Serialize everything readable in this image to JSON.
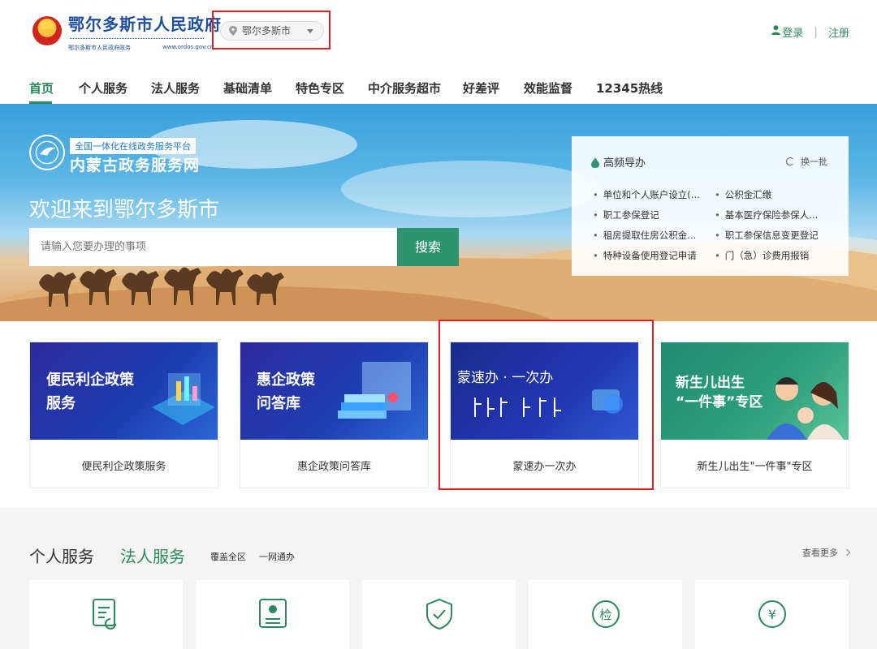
{
  "header": {
    "site_title": "鄂尔多斯市人民政府",
    "site_sub": "鄂尔多斯市人民政府政务",
    "site_domain": "www.ordos.gov.cn",
    "city_selector": "鄂尔多斯市",
    "login": "登录",
    "register": "注册"
  },
  "nav": {
    "items": [
      "首页",
      "个人服务",
      "法人服务",
      "基础清单",
      "特色专区",
      "中介服务超市",
      "好差评",
      "效能监督",
      "12345热线"
    ],
    "active_index": 0
  },
  "banner": {
    "platform_tag": "全国一体化在线政务服务平台",
    "platform_name": "内蒙古政务服务网",
    "welcome": "欢迎来到鄂尔多斯市",
    "search_placeholder": "请输入您要办理的事项",
    "search_button": "搜索"
  },
  "quick_guide": {
    "title": "高频导办",
    "refresh": "换一批",
    "items": [
      "单位和个人账户设立(...",
      "公积金汇缴",
      "职工参保登记",
      "基本医疗保险参保人...",
      "租房提取住房公积金...",
      "职工参保信息变更登记",
      "特种设备使用登记申请",
      "门（急）诊费用报销"
    ]
  },
  "cards": [
    {
      "image_text": [
        "便民利企政策",
        "服务"
      ],
      "label": "便民利企政策服务"
    },
    {
      "image_text": [
        "惠企政策",
        "问答库"
      ],
      "label": "惠企政策问答库"
    },
    {
      "image_text": [
        "蒙速办 · 一次办"
      ],
      "label": "蒙速办一次办"
    },
    {
      "image_text": [
        "新生儿出生",
        "“一件事”专区"
      ],
      "label": "新生儿出生\"一件事\"专区"
    }
  ],
  "services": {
    "tab_personal": "个人服务",
    "tab_legal": "法人服务",
    "cover_1": "覆盖全区",
    "cover_2": "一网通办",
    "more": "查看更多"
  },
  "tile_icons": [
    "form-refresh-icon",
    "id-card-icon",
    "shield-check-icon",
    "inspect-icon",
    "yuan-icon"
  ],
  "colors": {
    "brand_green": "#2a8a5c",
    "brand_blue": "#1f4f9e",
    "highlight_red": "#e02020"
  }
}
